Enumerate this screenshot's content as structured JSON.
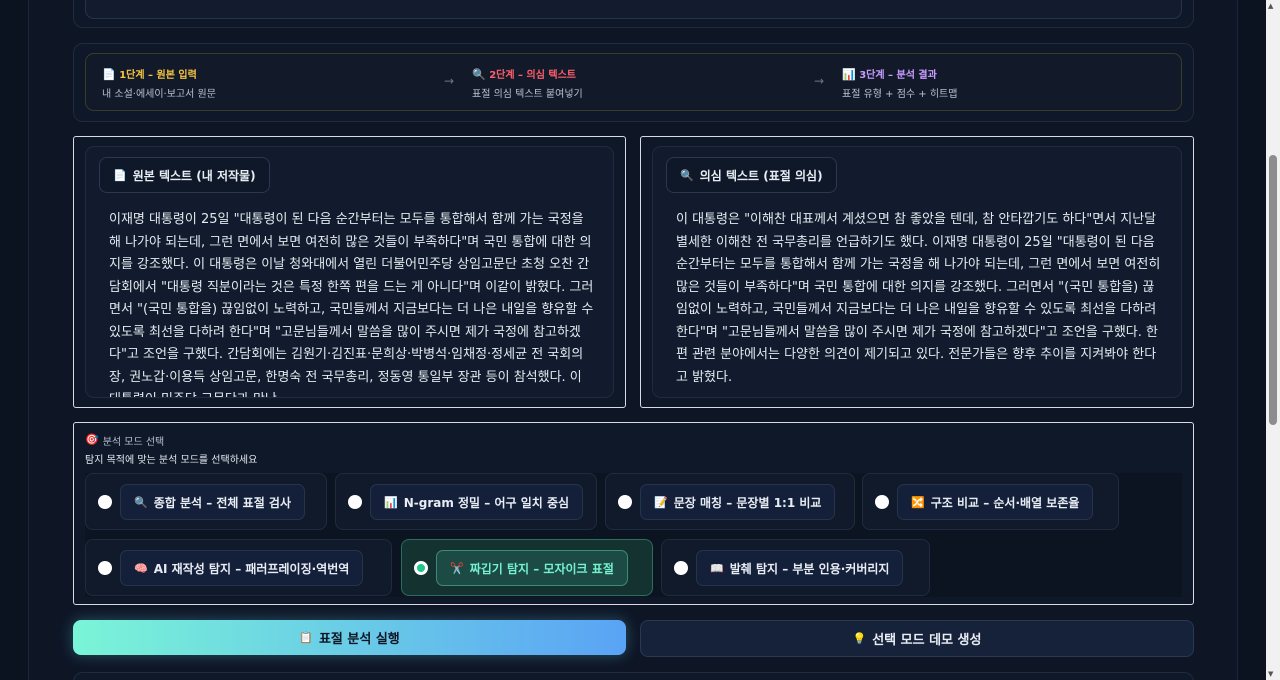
{
  "steps": [
    {
      "icon": "📄",
      "title": "1단계 – 원본 입력",
      "desc": "내 소설·에세이·보고서 원문"
    },
    {
      "icon": "🔍",
      "title": "2단계 – 의심 텍스트",
      "desc": "표절 의심 텍스트 붙여넣기"
    },
    {
      "icon": "📊",
      "title": "3단계 – 분석 결과",
      "desc": "표절 유형 + 점수 + 히트맵"
    }
  ],
  "arrow": "→",
  "original": {
    "icon": "📄",
    "label": "원본 텍스트 (내 저작물)",
    "text": "이재명 대통령이 25일 \"대통령이 된 다음 순간부터는 모두를 통합해서 함께 가는 국정을 해 나가야 되는데, 그런 면에서 보면 여전히 많은 것들이 부족하다\"며 국민 통합에 대한 의지를 강조했다. 이 대통령은 이날 청와대에서 열린 더불어민주당 상임고문단 초청 오찬 간담회에서 \"대통령 직분이라는 것은 특정 한쪽 편을 드는 게 아니다\"며 이같이 밝혔다. 그러면서 \"(국민 통합을) 끊임없이 노력하고, 국민들께서 지금보다는 더 나은 내일을 향유할 수 있도록 최선을 다하려 한다\"며 \"고문님들께서 말씀을 많이 주시면 제가 국정에 참고하겠다\"고 조언을 구했다. 간담회에는 김원기·김진표·문희상·박병석·임채정·정세균 전 국회의장, 권노갑·이용득 상임고문, 한명숙 전 국무총리, 정동영 통일부 장관 등이 참석했다. 이 대통령이 민주당 고문단과 만난"
  },
  "suspect": {
    "icon": "🔍",
    "label": "의심 텍스트 (표절 의심)",
    "text": "이 대통령은 \"이해찬 대표께서 계셨으면 참 좋았을 텐데, 참 안타깝기도 하다\"면서 지난달 별세한 이해찬 전 국무총리를 언급하기도 했다. 이재명 대통령이 25일 \"대통령이 된 다음 순간부터는 모두를 통합해서 함께 가는 국정을 해 나가야 되는데, 그런 면에서 보면 여전히 많은 것들이 부족하다\"며 국민 통합에 대한 의지를 강조했다. 그러면서 \"(국민 통합을) 끊임없이 노력하고, 국민들께서 지금보다는 더 나은 내일을 향유할 수 있도록 최선을 다하려 한다\"며 \"고문님들께서 말씀을 많이 주시면 제가 국정에 참고하겠다\"고 조언을 구했다. 한편 관련 분야에서는 다양한 의견이 제기되고 있다. 전문가들은 향후 추이를 지켜봐야 한다고 밝혔다."
  },
  "mode_select": {
    "icon": "🎯",
    "title": "분석 모드 선택",
    "subtitle": "탐지 목적에 맞는 분석 모드를 선택하세요",
    "modes": [
      {
        "icon": "🔍",
        "label": "종합 분석 – 전체 표절 검사",
        "selected": false
      },
      {
        "icon": "📊",
        "label": "N-gram 정밀 – 어구 일치 중심",
        "selected": false
      },
      {
        "icon": "📝",
        "label": "문장 매칭 – 문장별 1:1 비교",
        "selected": false
      },
      {
        "icon": "🔀",
        "label": "구조 비교 – 순서·배열 보존율",
        "selected": false
      },
      {
        "icon": "🧠",
        "label": "AI 재작성 탐지 – 패러프레이징·역번역",
        "selected": false
      },
      {
        "icon": "✂️",
        "label": "짜깁기 탐지 – 모자이크 표절",
        "selected": true
      },
      {
        "icon": "📖",
        "label": "발췌 탐지 – 부분 인용·커버리지",
        "selected": false
      }
    ]
  },
  "buttons": {
    "run": {
      "icon": "📋",
      "label": "표절 분석 실행"
    },
    "demo": {
      "icon": "💡",
      "label": "선택 모드 데모 생성"
    }
  },
  "colors": {
    "step1": "#f5c542",
    "step2": "#ff5e6c",
    "step3": "#c79bff",
    "accent_selected": "#22c58a"
  }
}
